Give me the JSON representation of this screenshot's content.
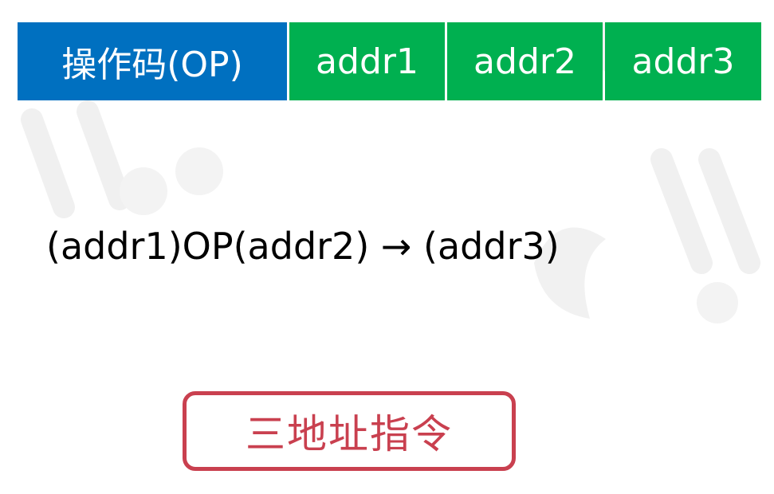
{
  "instruction_format": {
    "fields": [
      {
        "label": "操作码(OP)",
        "color": "#0070c0"
      },
      {
        "label": "addr1",
        "color": "#00b050"
      },
      {
        "label": "addr2",
        "color": "#00b050"
      },
      {
        "label": "addr3",
        "color": "#00b050"
      }
    ]
  },
  "operation": {
    "expression": "(addr1)OP(addr2) → (addr3)"
  },
  "caption": {
    "label": "三地址指令",
    "color": "#c9404f"
  }
}
